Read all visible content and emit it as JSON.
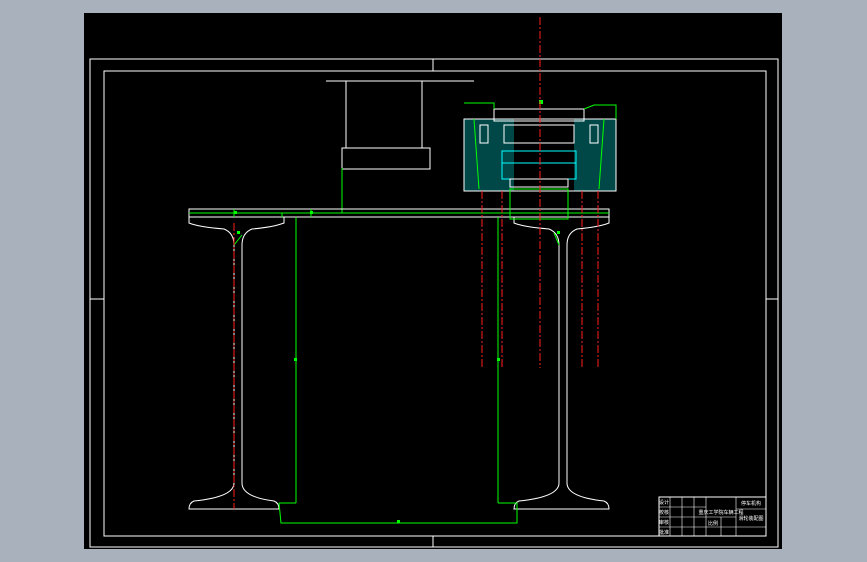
{
  "viewport": {
    "background": "#a9b1bd"
  },
  "drawing": {
    "background": "#000000",
    "line_colors": {
      "outline": "#ffffff",
      "dimension": "#00ff00",
      "centerline": "#ff2020",
      "section": "#00ffff"
    }
  },
  "title_block": {
    "drawing_name": "停车机构",
    "sheet_title": "滑轮装配图",
    "sub_label": "重庆工学院车辆工程",
    "scale_label": "比例",
    "row_labels": [
      "设计",
      "校核",
      "审核",
      "批准"
    ]
  }
}
